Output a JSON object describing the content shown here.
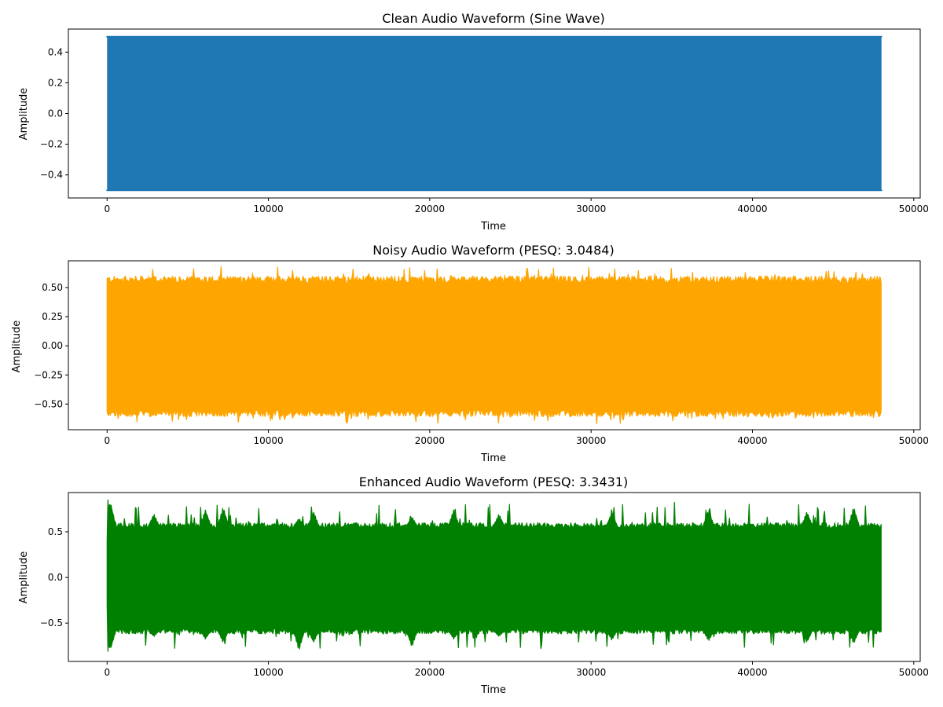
{
  "chart_data": [
    {
      "type": "line",
      "title": "Clean Audio Waveform (Sine Wave)",
      "xlabel": "Time",
      "ylabel": "Amplitude",
      "xlim": [
        -2400,
        50400
      ],
      "ylim": [
        -0.55,
        0.55
      ],
      "xticks": [
        0,
        10000,
        20000,
        30000,
        40000,
        50000
      ],
      "xtick_labels": [
        "0",
        "10000",
        "20000",
        "30000",
        "40000",
        "50000"
      ],
      "yticks": [
        -0.4,
        -0.2,
        0.0,
        0.2,
        0.4
      ],
      "ytick_labels": [
        "−0.4",
        "−0.2",
        "0.0",
        "0.2",
        "0.4"
      ],
      "grid": false,
      "series": [
        {
          "color": "#1f77b4",
          "x_range": [
            0,
            48000
          ],
          "amplitude": 0.5,
          "envelope_upper": [
            0.5,
            0.5,
            0.5,
            0.5,
            0.5,
            0.5,
            0.5,
            0.5,
            0.5,
            0.5
          ],
          "envelope_lower": [
            -0.5,
            -0.5,
            -0.5,
            -0.5,
            -0.5,
            -0.5,
            -0.5,
            -0.5,
            -0.5,
            -0.5
          ]
        }
      ]
    },
    {
      "type": "line",
      "title": "Noisy Audio Waveform (PESQ: 3.0484)",
      "xlabel": "Time",
      "ylabel": "Amplitude",
      "xlim": [
        -2400,
        50400
      ],
      "ylim": [
        -0.72,
        0.73
      ],
      "xticks": [
        0,
        10000,
        20000,
        30000,
        40000,
        50000
      ],
      "xtick_labels": [
        "0",
        "10000",
        "20000",
        "30000",
        "40000",
        "50000"
      ],
      "yticks": [
        -0.5,
        -0.25,
        0.0,
        0.25,
        0.5
      ],
      "ytick_labels": [
        "−0.50",
        "−0.25",
        "0.00",
        "0.25",
        "0.50"
      ],
      "grid": false,
      "series": [
        {
          "color": "#ffa500",
          "x_range": [
            0,
            48000
          ],
          "amplitude": 0.5,
          "base_upper": 0.56,
          "base_lower": -0.57,
          "peak_max": 0.68,
          "peak_min": -0.67
        }
      ]
    },
    {
      "type": "line",
      "title": "Enhanced Audio Waveform (PESQ: 3.3431)",
      "xlabel": "Time",
      "ylabel": "Amplitude",
      "xlim": [
        -2400,
        50400
      ],
      "ylim": [
        -0.92,
        0.93
      ],
      "xticks": [
        0,
        10000,
        20000,
        30000,
        40000,
        50000
      ],
      "xtick_labels": [
        "0",
        "10000",
        "20000",
        "30000",
        "40000",
        "50000"
      ],
      "yticks": [
        -0.5,
        0.0,
        0.5
      ],
      "ytick_labels": [
        "−0.5",
        "0.0",
        "0.5"
      ],
      "grid": false,
      "series": [
        {
          "color": "#008000",
          "x_range": [
            0,
            48000
          ],
          "base_upper": 0.56,
          "base_lower": -0.58,
          "peak_max": 0.85,
          "peak_min": -0.81,
          "bursts": [
            {
              "x": 200,
              "upper": 0.85,
              "lower": -0.81
            },
            {
              "x": 2900,
              "upper": 0.7,
              "lower": -0.65
            },
            {
              "x": 6100,
              "upper": 0.75,
              "lower": -0.68
            },
            {
              "x": 7200,
              "upper": 0.78,
              "lower": -0.72
            },
            {
              "x": 11900,
              "upper": 0.65,
              "lower": -0.81
            },
            {
              "x": 12800,
              "upper": 0.73,
              "lower": -0.72
            },
            {
              "x": 18900,
              "upper": 0.67,
              "lower": -0.77
            },
            {
              "x": 21500,
              "upper": 0.75,
              "lower": -0.68
            },
            {
              "x": 24300,
              "upper": 0.7,
              "lower": -0.65
            },
            {
              "x": 31300,
              "upper": 0.72,
              "lower": -0.69
            },
            {
              "x": 37300,
              "upper": 0.75,
              "lower": -0.7
            },
            {
              "x": 43400,
              "upper": 0.73,
              "lower": -0.72
            },
            {
              "x": 46300,
              "upper": 0.78,
              "lower": -0.73
            }
          ]
        }
      ]
    }
  ]
}
